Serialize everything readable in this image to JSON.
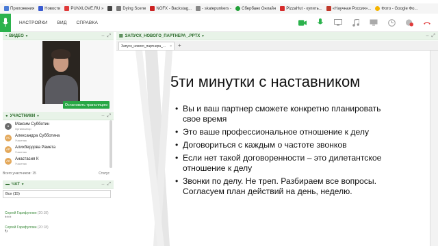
{
  "bookmarks": [
    {
      "label": "Приложения",
      "color": "#4a7bd6"
    },
    {
      "label": "Новости",
      "color": "#3a5bd0"
    },
    {
      "label": "PUNXLOVE.RU »",
      "color": "#e03a3a"
    },
    {
      "label": "",
      "color": "#444444"
    },
    {
      "label": "Dying Scene",
      "color": "#777777"
    },
    {
      "label": "NOFX - Backstag...",
      "color": "#cc2222"
    },
    {
      "label": "- skatepunkers -",
      "color": "#888888"
    },
    {
      "label": "Сбербанк Онлайн",
      "color": "#21a038"
    },
    {
      "label": "PizzaHut - купить...",
      "color": "#d62b2b"
    },
    {
      "label": "«Научная Россия»...",
      "color": "#c0392b"
    },
    {
      "label": "Фото - Google Фо...",
      "color": "#f4b400"
    }
  ],
  "menu": [
    "НАСТРОЙКИ",
    "ВИД",
    "СПРАВКА"
  ],
  "video_panel": {
    "title": "ВИДЕО",
    "stop_button": "Остановить трансляцию"
  },
  "participants": {
    "title": "УЧАСТНИКИ",
    "people": [
      {
        "name": "Максим Субботин",
        "role": "Организатор",
        "initials": "",
        "color": "#6b6b6b"
      },
      {
        "name": "Александра Субботина",
        "role": "Участник",
        "initials": "АС",
        "color": "#e3a85a"
      },
      {
        "name": "Алихбердова Рамета",
        "role": "Участник",
        "initials": "АР",
        "color": "#e3a85a"
      },
      {
        "name": "Анастасия К",
        "role": "Участник",
        "initials": "АК",
        "color": "#e3a85a"
      }
    ],
    "footer_count": "Всего участников: 15",
    "footer_status": "Статус"
  },
  "chat": {
    "title": "ЧАТ",
    "filter": "Все (15)",
    "messages": [
      {
        "name": "Сергей Гарифуллин",
        "time": "(20:18)",
        "text": "+++"
      },
      {
        "name": "Сергей Гарифуллин",
        "time": "(20:18)",
        "text": "↻"
      }
    ]
  },
  "document": {
    "panel_title": "ЗАПУСК_НОВОГО_ПАРТНЕРА_.PPTX",
    "tab_label": "Запуск_нового_партнера_...",
    "slide_title": "5ти минутки с наставником",
    "bullets": [
      "Вы и ваш партнер сможете конкретно планировать свое время",
      "Это ваше профессиональное отношение к делу",
      "Договориться с каждым о частоте звонков",
      " Если нет такой договоренности – это дилетантское отношение к делу",
      "Звонки по делу. Не треп. Разбираем все вопросы. Согласуем план действий на день, неделю."
    ]
  },
  "colors": {
    "brand": "#2bb24c",
    "header_green": "#2b6b2b",
    "stop_button": "#28a745"
  }
}
